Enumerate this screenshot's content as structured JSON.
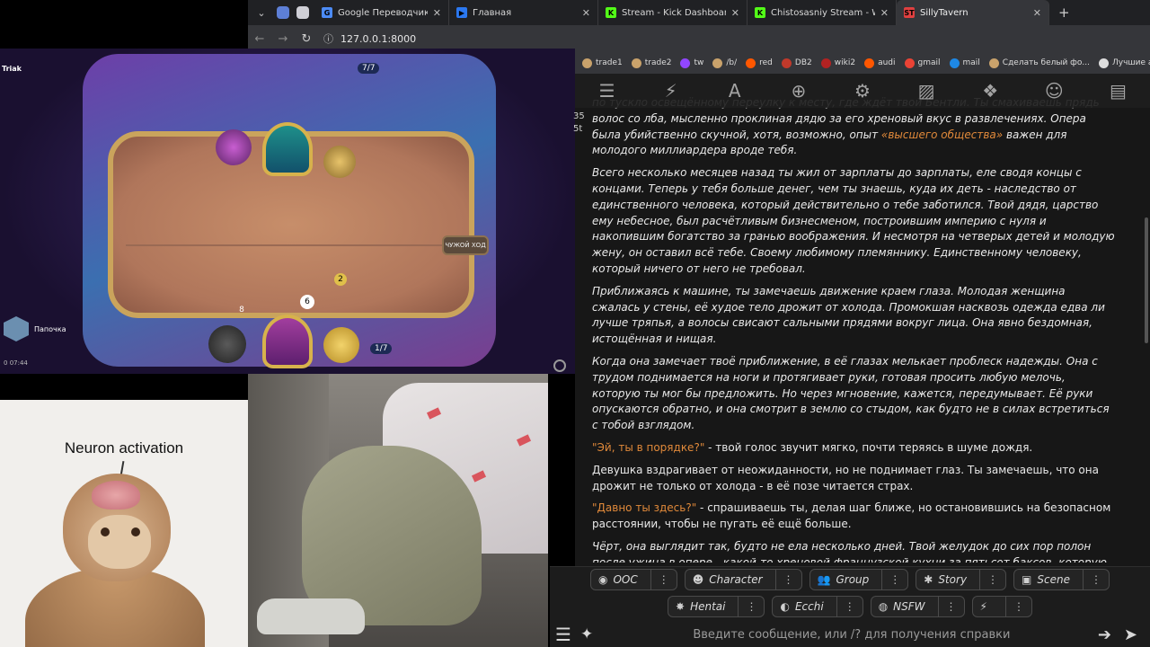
{
  "browser": {
    "tabs": [
      {
        "title": "Google Переводчик",
        "fav_color": "#4c8bf5",
        "fav_letter": "G"
      },
      {
        "title": "Главная",
        "fav_color": "#2b78f0",
        "fav_letter": "▶"
      },
      {
        "title": "Stream - Kick Dashboard",
        "fav_color": "#53fc18",
        "fav_letter": "K"
      },
      {
        "title": "Chistosasniy Stream - Watch Li...",
        "fav_color": "#53fc18",
        "fav_letter": "K"
      },
      {
        "title": "SillyTavern",
        "fav_color": "#e04040",
        "fav_letter": "ST"
      }
    ],
    "active_tab": 4,
    "url": "127.0.0.1:8000",
    "bookmarks": [
      {
        "label": "trade1",
        "color": "#c9a26b"
      },
      {
        "label": "trade2",
        "color": "#c9a26b"
      },
      {
        "label": "tw",
        "color": "#9146ff"
      },
      {
        "label": "/b/",
        "color": "#c9a26b"
      },
      {
        "label": "red",
        "color": "#ff5700"
      },
      {
        "label": "DB2",
        "color": "#c0392b"
      },
      {
        "label": "wiki2",
        "color": "#b22222"
      },
      {
        "label": "audi",
        "color": "#ff5700"
      },
      {
        "label": "gmail",
        "color": "#ea4335"
      },
      {
        "label": "mail",
        "color": "#1e88e5"
      },
      {
        "label": "Сделать белый фо...",
        "color": "#c9a26b"
      },
      {
        "label": "Лучшие аниме",
        "color": "#dddddd"
      }
    ]
  },
  "stream": {
    "channel": "Triak",
    "opponent_cards": "7/7",
    "player_cards": "1/7",
    "end_turn": "ЧУЖОЙ ХОД",
    "player_name": "Папочка",
    "viewer_stats": "07:44",
    "viewers": "0",
    "hero_health": "6",
    "armor": "8",
    "mana": "2"
  },
  "meme": {
    "caption": "Neuron activation"
  },
  "tavern": {
    "side_numbers": [
      "35",
      "5t"
    ],
    "messages": [
      {
        "type": "italic",
        "parts": [
          {
            "t": "по тускло освещённому переулку к месту, где ждёт твой Бентли. Ты смахиваешь прядь волос со лба, мысленно проклиная дядю за его хреновый вкус в развлечениях. Опера была убийственно скучной, хотя, возможно, опыт "
          },
          {
            "t": "«высшего общества»",
            "q": true
          },
          {
            "t": " важен для молодого миллиардера вроде тебя."
          }
        ]
      },
      {
        "type": "italic",
        "parts": [
          {
            "t": "Всего несколько месяцев назад ты жил от зарплаты до зарплаты, еле сводя концы с концами. Теперь у тебя больше денег, чем ты знаешь, куда их деть - наследство от единственного человека, который действительно о тебе заботился. Твой дядя, царство ему небесное, был расчётливым бизнесменом, построившим империю с нуля и накопившим богатство за гранью воображения. И несмотря на четверых детей и молодую жену, он оставил всё тебе. Своему любимому племяннику. Единственному человеку, который ничего от него не требовал."
          }
        ]
      },
      {
        "type": "italic",
        "parts": [
          {
            "t": "Приближаясь к машине, ты замечаешь движение краем глаза. Молодая женщина сжалась у стены, её худое тело дрожит от холода. Промокшая насквозь одежда едва ли лучше тряпья, а волосы свисают сальными прядями вокруг лица. Она явно бездомная, истощённая и нищая."
          }
        ]
      },
      {
        "type": "italic",
        "parts": [
          {
            "t": "Когда она замечает твоё приближение, в её глазах мелькает проблеск надежды. Она с трудом поднимается на ноги и протягивает руки, готовая просить любую мелочь, которую ты мог бы предложить. Но через мгновение, кажется, передумывает. Её руки опускаются обратно, и она смотрит в землю со стыдом, как будто не в силах встретиться с тобой взглядом."
          }
        ]
      },
      {
        "type": "plain",
        "parts": [
          {
            "t": "\"Эй, ты в порядке?\"",
            "q": true
          },
          {
            "t": " - твой голос звучит мягко, почти теряясь в шуме дождя."
          }
        ]
      },
      {
        "type": "plain",
        "parts": [
          {
            "t": "Девушка вздрагивает от неожиданности, но не поднимает глаз. Ты замечаешь, что она дрожит не только от холода - в её позе читается страх."
          }
        ]
      },
      {
        "type": "plain",
        "parts": [
          {
            "t": "\"Давно ты здесь?\"",
            "q": true
          },
          {
            "t": " - спрашиваешь ты, делая шаг ближе, но остановившись на безопасном расстоянии, чтобы не пугать её ещё больше."
          }
        ]
      },
      {
        "type": "italic",
        "parts": [
          {
            "t": "Чёрт, она выглядит так, будто не ела несколько дней. Твой желудок до сих пор полон после ужина в опере - какой-то хреновой французской кухни за пятьсот баксов, которую ты едва смог заставить себя проглотить."
          }
        ]
      }
    ],
    "quick_replies_row1": [
      {
        "label": "OOC",
        "icon": "◉"
      },
      {
        "label": "Character",
        "icon": "☻"
      },
      {
        "label": "Group",
        "icon": "👥"
      },
      {
        "label": "Story",
        "icon": "✱"
      },
      {
        "label": "Scene",
        "icon": "▣"
      }
    ],
    "quick_replies_row2": [
      {
        "label": "Hentai",
        "icon": "✸"
      },
      {
        "label": "Ecchi",
        "icon": "◐"
      },
      {
        "label": "NSFW",
        "icon": "◍"
      },
      {
        "label": "",
        "icon": "⚡"
      }
    ],
    "dots": "⋮",
    "input_placeholder": "Введите сообщение, или /? для получения справки"
  }
}
